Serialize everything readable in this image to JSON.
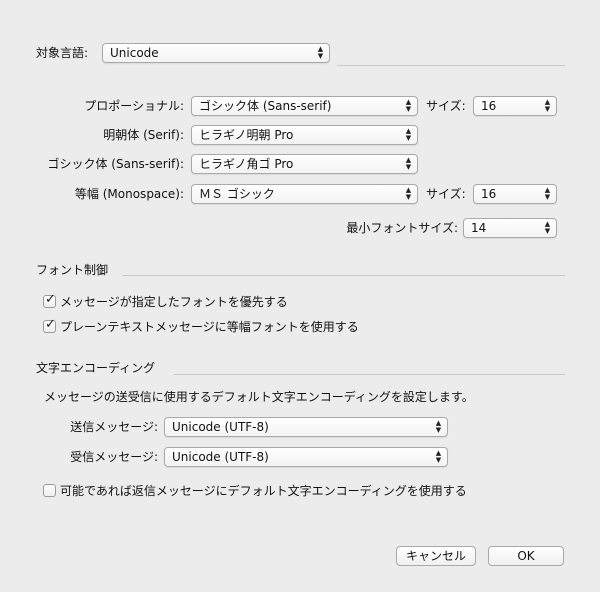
{
  "language": {
    "label": "対象言語:",
    "value": "Unicode"
  },
  "fonts": {
    "proportional": {
      "label": "プロポーショナル:",
      "value": "ゴシック体 (Sans-serif)",
      "size_label": "サイズ:",
      "size_value": "16"
    },
    "serif": {
      "label": "明朝体 (Serif):",
      "value": "ヒラギノ明朝 Pro"
    },
    "sans": {
      "label": "ゴシック体 (Sans-serif):",
      "value": "ヒラギノ角ゴ Pro"
    },
    "mono": {
      "label": "等幅 (Monospace):",
      "value": "ＭＳ ゴシック",
      "size_label": "サイズ:",
      "size_value": "16"
    },
    "min_size": {
      "label": "最小フォントサイズ:",
      "value": "14"
    }
  },
  "font_control": {
    "title": "フォント制御",
    "options": [
      {
        "label": "メッセージが指定したフォントを優先する",
        "checked": true
      },
      {
        "label": "プレーンテキストメッセージに等幅フォントを使用する",
        "checked": true
      }
    ]
  },
  "encoding": {
    "title": "文字エンコーディング",
    "description": "メッセージの送受信に使用するデフォルト文字エンコーディングを設定します。",
    "outgoing_label": "送信メッセージ:",
    "outgoing_value": "Unicode (UTF-8)",
    "incoming_label": "受信メッセージ:",
    "incoming_value": "Unicode (UTF-8)",
    "reply_option": {
      "label": "可能であれば返信メッセージにデフォルト文字エンコーディングを使用する",
      "checked": false
    }
  },
  "buttons": {
    "cancel": "キャンセル",
    "ok": "OK"
  },
  "icons": {
    "popup_arrows": "▲▼",
    "check": "✓"
  }
}
